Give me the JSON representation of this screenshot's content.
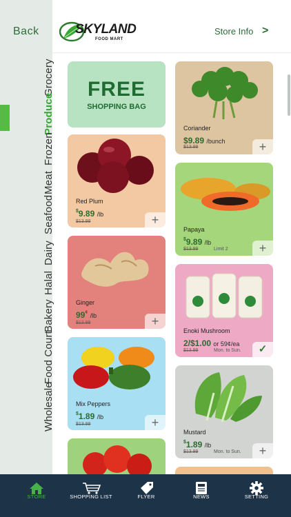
{
  "header": {
    "back_label": "Back",
    "logo_brand": "SKYLAND",
    "logo_sub": "FOOD MART",
    "store_info_label": "Store Info"
  },
  "categories": [
    "Grocery",
    "Produce",
    "Frozen",
    "Meat",
    "Seafood",
    "Dairy",
    "Halal",
    "Bakery",
    "Food Court",
    "Wholesale"
  ],
  "active_category": "Produce",
  "promo": {
    "title": "FREE",
    "subtitle": "SHOPPING BAG"
  },
  "products": [
    {
      "name": "Red Plum",
      "price_int": "9.89",
      "price_prefix": "$",
      "unit": "/lb",
      "old_price": "$13.99"
    },
    {
      "name": "Ginger",
      "price_int": "99",
      "price_suffix": "¢",
      "unit": "/lb",
      "old_price": "$13.99"
    },
    {
      "name": "Mix Peppers",
      "price_int": "1.89",
      "price_prefix": "$",
      "unit": "/lb",
      "old_price": "$13.99"
    },
    {
      "name": "Coriander",
      "price_int": "$9.89",
      "unit": "/bunch",
      "old_price": "$13.99"
    },
    {
      "name": "Papaya",
      "price_int": "9.89",
      "price_prefix": "$",
      "unit": "/lb",
      "old_price": "$13.99",
      "note": "Limit 2"
    },
    {
      "name": "Enoki Mushroom",
      "price_int": "2/$1.00",
      "unit": "or 59¢/ea",
      "old_price": "$13.99",
      "note": "Mon. to Sun."
    },
    {
      "name": "Mustard",
      "price_int": "1.89",
      "price_prefix": "$",
      "unit": "/lb",
      "old_price": "$13.99",
      "note": "Mon. to Sun."
    }
  ],
  "bottom_nav": [
    {
      "label": "STORE",
      "icon": "home-icon",
      "active": true
    },
    {
      "label": "SHOPPING LIST",
      "icon": "cart-icon",
      "active": false
    },
    {
      "label": "FLYER",
      "icon": "tag-icon",
      "active": false
    },
    {
      "label": "NEWS",
      "icon": "newspaper-icon",
      "active": false
    },
    {
      "label": "SETTING",
      "icon": "gear-icon",
      "active": false
    }
  ],
  "colors": {
    "brand_green": "#3aa635",
    "nav_background": "#1d3347",
    "rail_background": "#e4ebe7"
  }
}
